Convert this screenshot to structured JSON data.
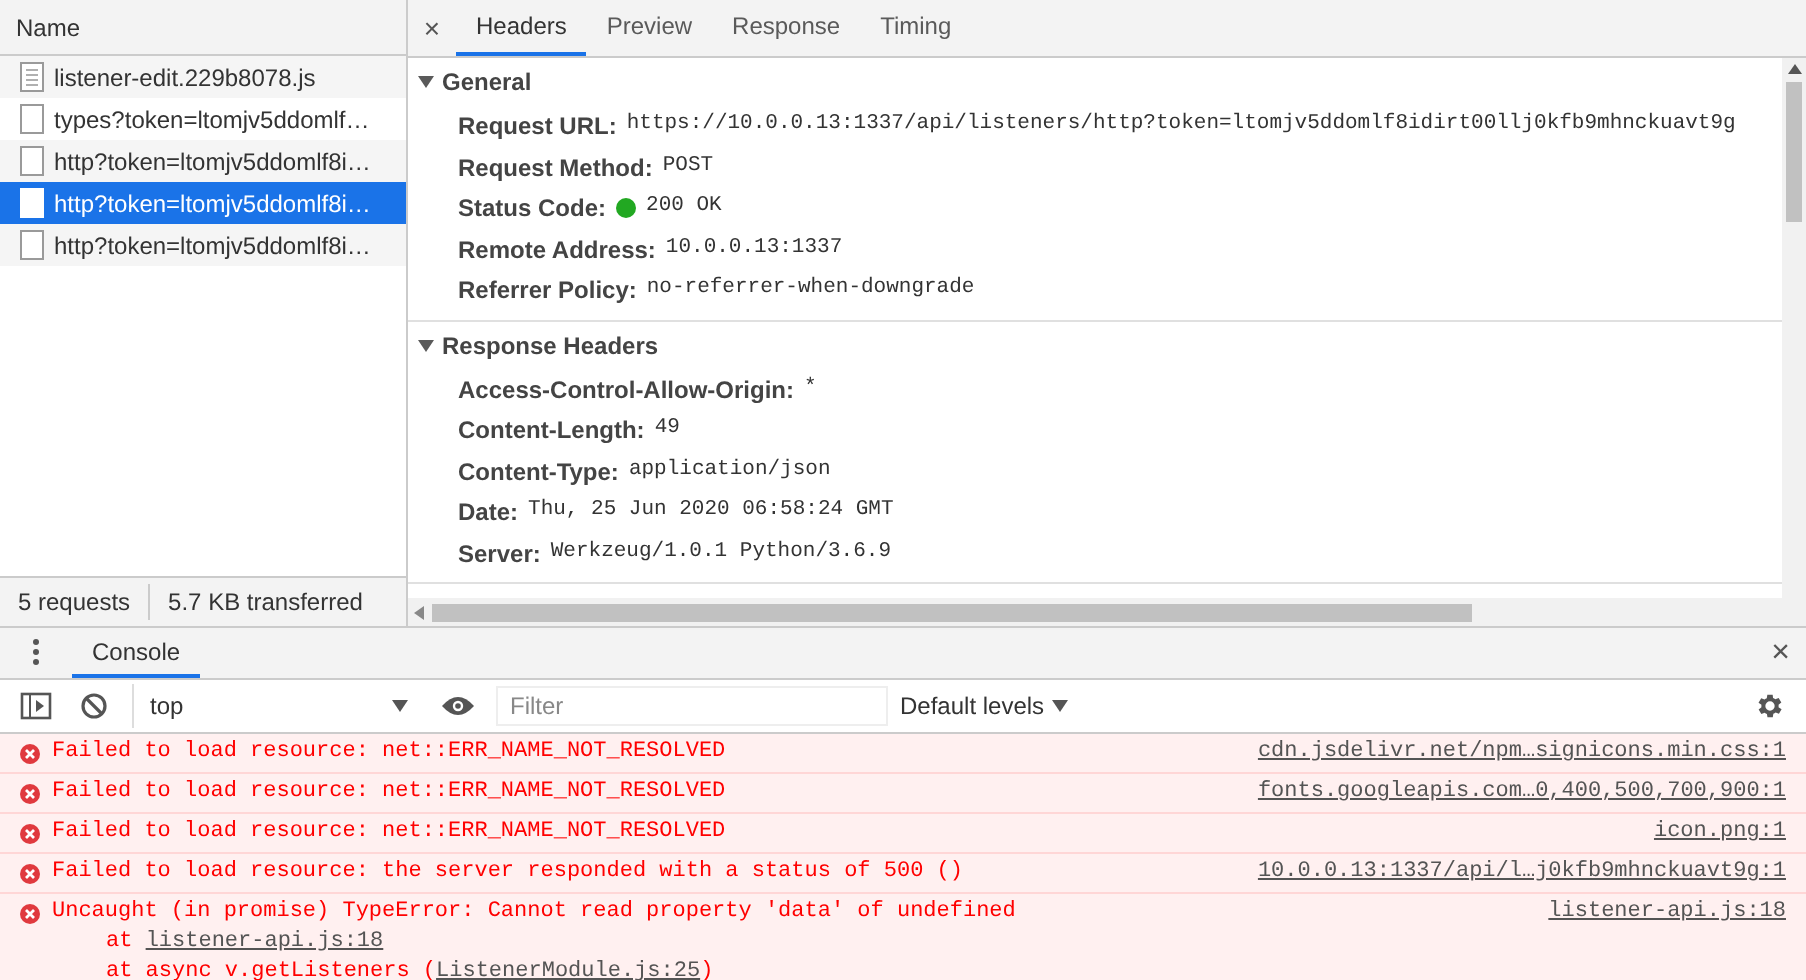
{
  "network": {
    "column_header": "Name",
    "requests": [
      {
        "name": "listener-edit.229b8078.js",
        "kind": "script",
        "selected": false
      },
      {
        "name": "types?token=ltomjv5ddomlf…",
        "kind": "document",
        "selected": false
      },
      {
        "name": "http?token=ltomjv5ddomlf8i…",
        "kind": "document",
        "selected": false
      },
      {
        "name": "http?token=ltomjv5ddomlf8i…",
        "kind": "document",
        "selected": true
      },
      {
        "name": "http?token=ltomjv5ddomlf8i…",
        "kind": "document",
        "selected": false
      }
    ],
    "summary": [
      "5 requests",
      "5.7 KB transferred"
    ]
  },
  "details": {
    "close": "×",
    "tabs": [
      {
        "label": "Headers",
        "selected": true
      },
      {
        "label": "Preview",
        "selected": false
      },
      {
        "label": "Response",
        "selected": false
      },
      {
        "label": "Timing",
        "selected": false
      }
    ],
    "sections": [
      {
        "title": "General",
        "expanded": true,
        "rows": [
          {
            "key": "Request URL:",
            "value": "https://10.0.0.13:1337/api/listeners/http?token=ltomjv5ddomlf8idirt00llj0kfb9mhnckuavt9g"
          },
          {
            "key": "Request Method:",
            "value": "POST"
          },
          {
            "key": "Status Code:",
            "value": "200 OK",
            "color": "#22a822"
          },
          {
            "key": "Remote Address:",
            "value": "10.0.0.13:1337"
          },
          {
            "key": "Referrer Policy:",
            "value": "no-referrer-when-downgrade"
          }
        ]
      },
      {
        "title": "Response Headers",
        "expanded": true,
        "rows": [
          {
            "key": "Access-Control-Allow-Origin:",
            "value": "*"
          },
          {
            "key": "Content-Length:",
            "value": "49"
          },
          {
            "key": "Content-Type:",
            "value": "application/json"
          },
          {
            "key": "Date:",
            "value": "Thu, 25 Jun 2020 06:58:24 GMT"
          },
          {
            "key": "Server:",
            "value": "Werkzeug/1.0.1 Python/3.6.9"
          }
        ]
      }
    ]
  },
  "console": {
    "tab": "Console",
    "close": "×",
    "context": "top",
    "filter_placeholder": "Filter",
    "levels": "Default levels",
    "messages": [
      {
        "kind": "error",
        "text": "Failed to load resource: net::ERR_NAME_NOT_RESOLVED",
        "source": "cdn.jsdelivr.net/npm…signicons.min.css:1"
      },
      {
        "kind": "error",
        "text": "Failed to load resource: net::ERR_NAME_NOT_RESOLVED",
        "source": "fonts.googleapis.com…0,400,500,700,900:1"
      },
      {
        "kind": "error",
        "text": "Failed to load resource: net::ERR_NAME_NOT_RESOLVED",
        "source": "icon.png:1"
      },
      {
        "kind": "error",
        "text": "Failed to load resource: the server responded with a status of 500 ()",
        "source": "10.0.0.13:1337/api/l…j0kfb9mhnckuavt9g:1"
      },
      {
        "kind": "error",
        "text": "Uncaught (in promise) TypeError: Cannot read property 'data' of undefined",
        "source": "listener-api.js:18",
        "stack": [
          {
            "prefix": "at ",
            "link": "listener-api.js:18"
          },
          {
            "prefix": "at async v.getListeners (",
            "link": "ListenerModule.js:25",
            "suffix": ")"
          }
        ]
      }
    ]
  }
}
